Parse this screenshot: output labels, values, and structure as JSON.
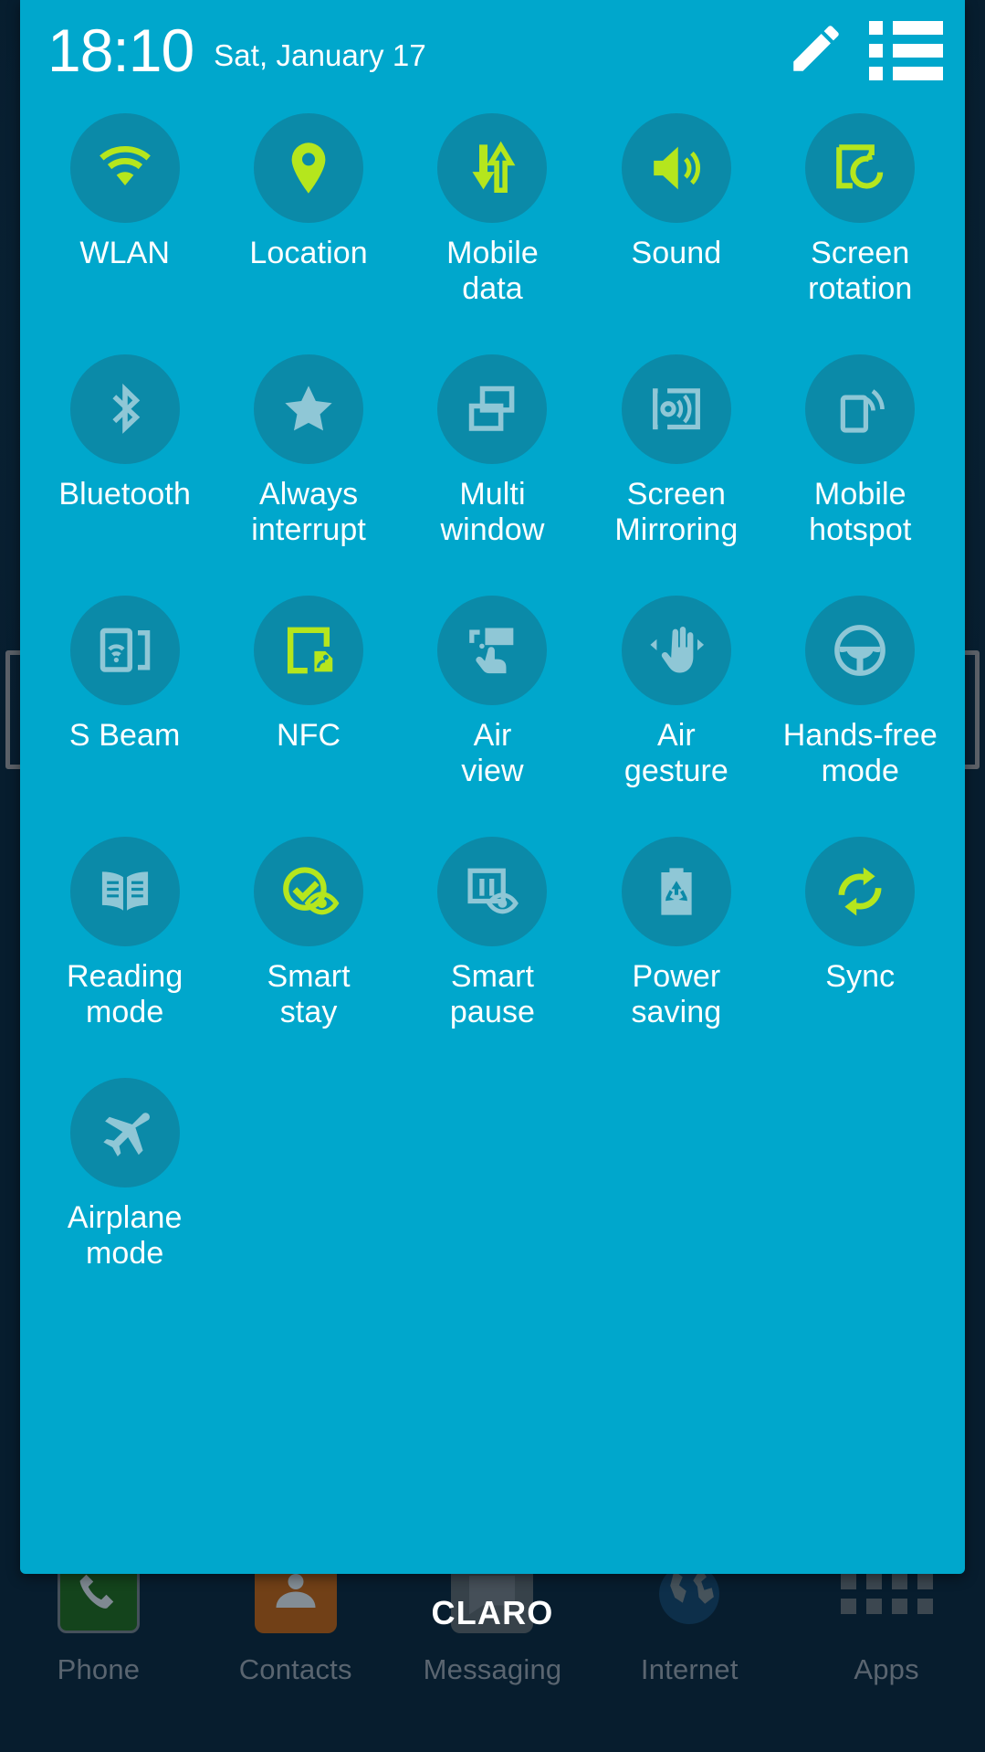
{
  "status": {
    "time": "18:10",
    "date": "Sat, January 17",
    "edit_icon": "pencil-icon",
    "list_icon": "list-icon"
  },
  "colors": {
    "panel_bg": "#00a7cc",
    "circle_bg": "#0b8aa8",
    "active_icon": "#b5e61d",
    "inactive_icon": "#8fc7d6",
    "label": "#ffffff",
    "home_bg": "#08253c",
    "dock_label": "#5a6570"
  },
  "toggles": [
    {
      "label": "WLAN",
      "icon": "wifi-icon",
      "active": true
    },
    {
      "label": "Location",
      "icon": "location-pin-icon",
      "active": true
    },
    {
      "label": "Mobile\ndata",
      "icon": "mobile-data-icon",
      "active": true
    },
    {
      "label": "Sound",
      "icon": "sound-speaker-icon",
      "active": true
    },
    {
      "label": "Screen\nrotation",
      "icon": "screen-rotation-icon",
      "active": true
    },
    {
      "label": "Bluetooth",
      "icon": "bluetooth-icon",
      "active": false
    },
    {
      "label": "Always\ninterrupt",
      "icon": "star-icon",
      "active": false
    },
    {
      "label": "Multi\nwindow",
      "icon": "multi-window-icon",
      "active": false
    },
    {
      "label": "Screen\nMirroring",
      "icon": "screen-mirroring-icon",
      "active": false
    },
    {
      "label": "Mobile\nhotspot",
      "icon": "mobile-hotspot-icon",
      "active": false
    },
    {
      "label": "S Beam",
      "icon": "s-beam-icon",
      "active": false
    },
    {
      "label": "NFC",
      "icon": "nfc-tag-icon",
      "active": true
    },
    {
      "label": "Air\nview",
      "icon": "air-view-icon",
      "active": false
    },
    {
      "label": "Air\ngesture",
      "icon": "air-gesture-icon",
      "active": false
    },
    {
      "label": "Hands-free\nmode",
      "icon": "steering-wheel-icon",
      "active": false
    },
    {
      "label": "Reading\nmode",
      "icon": "open-book-icon",
      "active": false
    },
    {
      "label": "Smart\nstay",
      "icon": "smart-stay-icon",
      "active": true
    },
    {
      "label": "Smart\npause",
      "icon": "smart-pause-icon",
      "active": false
    },
    {
      "label": "Power\nsaving",
      "icon": "power-saving-icon",
      "active": false
    },
    {
      "label": "Sync",
      "icon": "sync-icon",
      "active": true
    },
    {
      "label": "Airplane\nmode",
      "icon": "airplane-icon",
      "active": false
    }
  ],
  "home": {
    "carrier": "CLARO",
    "dock": [
      {
        "label": "Phone",
        "icon": "phone-icon"
      },
      {
        "label": "Contacts",
        "icon": "contacts-icon"
      },
      {
        "label": "Messaging",
        "icon": "messaging-icon"
      },
      {
        "label": "Internet",
        "icon": "globe-icon"
      },
      {
        "label": "Apps",
        "icon": "apps-grid-icon"
      }
    ]
  }
}
